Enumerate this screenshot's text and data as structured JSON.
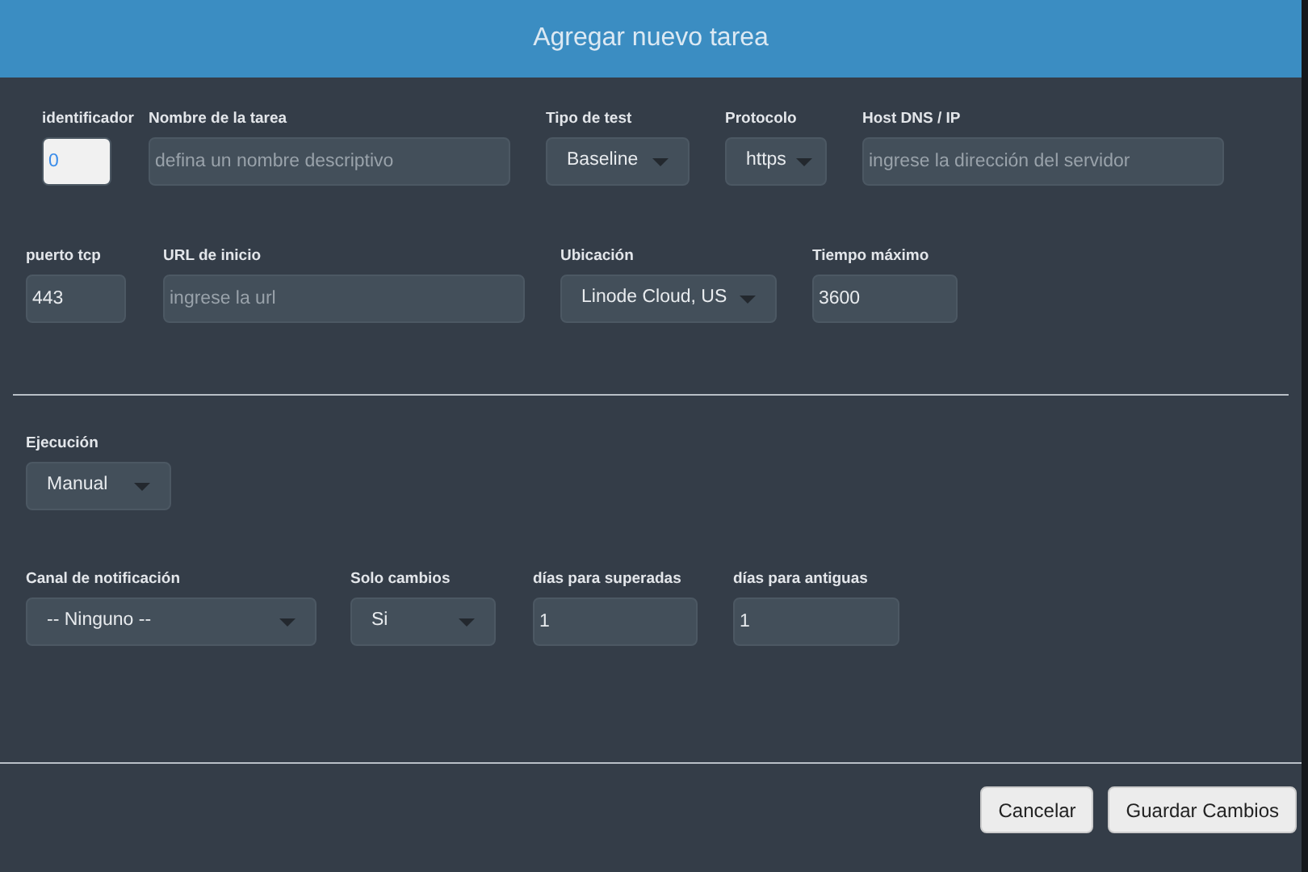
{
  "dialog": {
    "title": "Agregar nuevo tarea"
  },
  "sections": [
    {
      "rows": [
        [
          {
            "label": "identificador",
            "kind": "input",
            "value": "0",
            "focused": true
          },
          {
            "label": "Nombre de la tarea",
            "kind": "input",
            "placeholder": "defina un nombre descriptivo",
            "focused": false
          },
          {
            "label": "Tipo de test",
            "kind": "select",
            "value": "Baseline"
          },
          {
            "label": "Protocolo",
            "kind": "select",
            "value": "https"
          },
          {
            "label": "Host DNS / IP",
            "kind": "input",
            "placeholder": "ingrese la dirección del servidor",
            "focused": false
          }
        ],
        [
          {
            "label": "puerto tcp",
            "kind": "input",
            "value": "443",
            "focused": false
          },
          {
            "label": "URL de inicio",
            "kind": "input",
            "placeholder": "ingrese la url",
            "focused": false
          },
          {
            "label": "Ubicación",
            "kind": "select",
            "value": "Linode Cloud, US"
          },
          {
            "label": "Tiempo máximo",
            "kind": "input",
            "value": "3600",
            "focused": false
          }
        ]
      ]
    },
    {
      "rows": [
        [
          {
            "label": "Ejecución",
            "kind": "select",
            "value": "Manual"
          }
        ],
        [
          {
            "label": "Canal de notificación",
            "kind": "select",
            "value": "-- Ninguno --"
          },
          {
            "label": "Solo cambios",
            "kind": "select",
            "value": "Si"
          },
          {
            "label": "días para superadas",
            "kind": "input",
            "value": "1",
            "focused": false
          },
          {
            "label": "días para antiguas",
            "kind": "input",
            "value": "1",
            "focused": false
          }
        ]
      ]
    }
  ],
  "buttons": [
    {
      "label": "Cancelar"
    },
    {
      "label": "Guardar Cambios"
    }
  ]
}
